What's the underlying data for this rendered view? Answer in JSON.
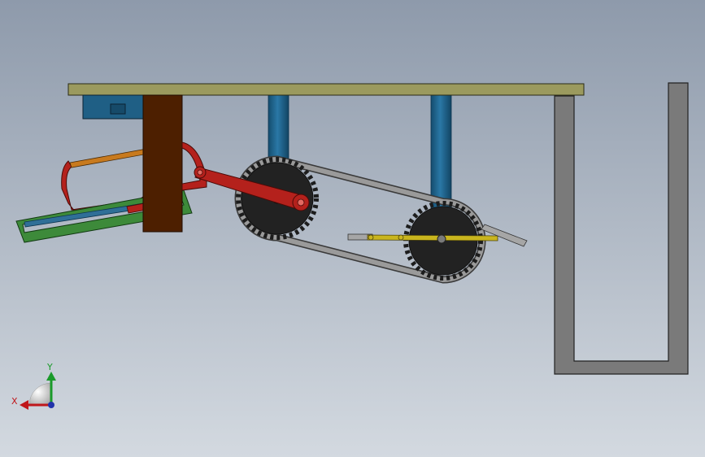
{
  "viewport": {
    "background_top": "#8e9aab",
    "background_bottom": "#d3d9e0"
  },
  "parts": [
    {
      "name": "table-top-plate",
      "color": "#9b9a5e"
    },
    {
      "name": "control-box",
      "color": "#1f5f85"
    },
    {
      "name": "wooden-post",
      "color": "#4d1f00"
    },
    {
      "name": "support-column",
      "color": "#1d5f86"
    },
    {
      "name": "saw-bow-frame",
      "color": "#b4211c"
    },
    {
      "name": "saw-blade-arm",
      "color": "#c87a1e"
    },
    {
      "name": "guide-rail",
      "color": "#3d8a3a"
    },
    {
      "name": "push-rod",
      "color": "#2f6f97"
    },
    {
      "name": "crank-link",
      "color": "#a81f28"
    },
    {
      "name": "drive-sprocket",
      "color": "#222222"
    },
    {
      "name": "driven-sprocket",
      "color": "#222222"
    },
    {
      "name": "chain-belt",
      "color": "#8a8a8a"
    },
    {
      "name": "pedal-crank",
      "color": "#c9b51e"
    },
    {
      "name": "u-frame",
      "color": "#7a7a7a"
    }
  ],
  "triad": {
    "x_label": "X",
    "y_label": "Y",
    "x_color": "#c0171b",
    "y_color": "#1a9a2a",
    "z_color": "#2233aa"
  }
}
